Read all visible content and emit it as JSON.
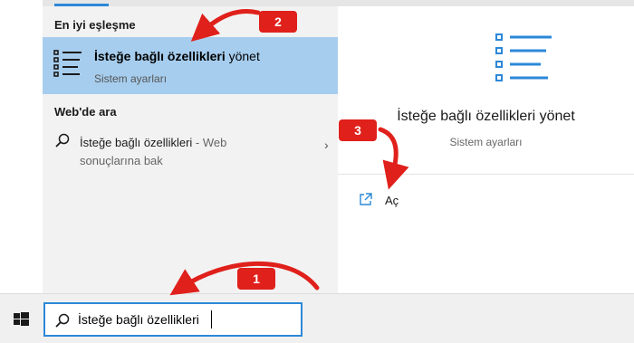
{
  "flyout": {
    "best_match_label": "En iyi eşleşme",
    "best_match": {
      "title_bold": "İsteğe bağlı özellikleri",
      "title_rest": " yönet",
      "subtitle": "Sistem ayarları"
    },
    "web_label": "Web'de ara",
    "web_item": {
      "bold": "İsteğe bağlı özellikleri",
      "hint": " - Web",
      "line2": "sonuçlarına bak"
    },
    "detail": {
      "title": "İsteğe bağlı özellikleri yönet",
      "subtitle": "Sistem ayarları",
      "open_label": "Aç"
    }
  },
  "taskbar": {
    "search_value": "İsteğe bağlı özellikleri"
  },
  "annotations": {
    "badge_1": "1",
    "badge_2": "2",
    "badge_3": "3"
  },
  "colors": {
    "highlight": "#a6cdee",
    "accent": "#2b88d8",
    "annotation_red": "#e0201b"
  },
  "icons": [
    "list-settings-icon",
    "search-icon",
    "open-icon",
    "windows-logo-icon",
    "chevron-right-icon"
  ]
}
